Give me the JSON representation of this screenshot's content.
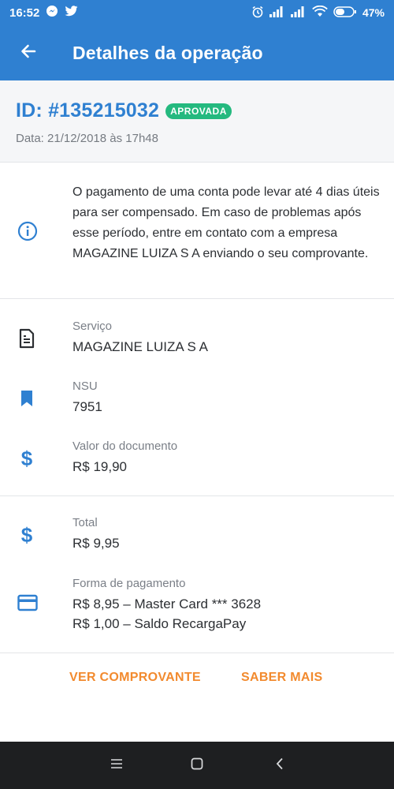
{
  "status_bar": {
    "time": "16:52",
    "battery": "47%",
    "icons": [
      "messenger-icon",
      "twitter-icon",
      "alarm-icon",
      "signal-icon",
      "signal-icon",
      "wifi-icon",
      "battery-icon"
    ]
  },
  "app_bar": {
    "title": "Detalhes da operação",
    "back_icon": "arrow-left-icon"
  },
  "operation": {
    "id": "ID: #135215032",
    "status": "APROVADA",
    "date": "Data: 21/12/2018 às 17h48"
  },
  "notice": {
    "icon": "info-icon",
    "text": "O pagamento de uma conta pode levar até 4 dias úteis para ser compensado. Em caso de problemas após esse período, entre em contato com a empresa MAGAZINE LUIZA S A enviando o seu comprovante."
  },
  "details": {
    "service": {
      "label": "Serviço",
      "value": "MAGAZINE LUIZA S A",
      "icon": "receipt-icon"
    },
    "nsu": {
      "label": "NSU",
      "value": "7951",
      "icon": "bookmark-icon"
    },
    "document_value": {
      "label": "Valor do documento",
      "value": "R$ 19,90",
      "icon": "dollar-icon"
    },
    "total": {
      "label": "Total",
      "value": "R$ 9,95",
      "icon": "dollar-icon"
    },
    "payment": {
      "label": "Forma de pagamento",
      "line1": "R$ 8,95 – Master Card *** 3628",
      "line2": "R$ 1,00 – Saldo RecargaPay",
      "icon": "credit-card-icon"
    }
  },
  "actions": {
    "view_receipt": "VER COMPROVANTE",
    "learn_more": "SABER MAIS"
  },
  "colors": {
    "primary": "#2f80d1",
    "success": "#24b97f",
    "accent": "#f28a2e",
    "nav_bar": "#1e1f21"
  }
}
